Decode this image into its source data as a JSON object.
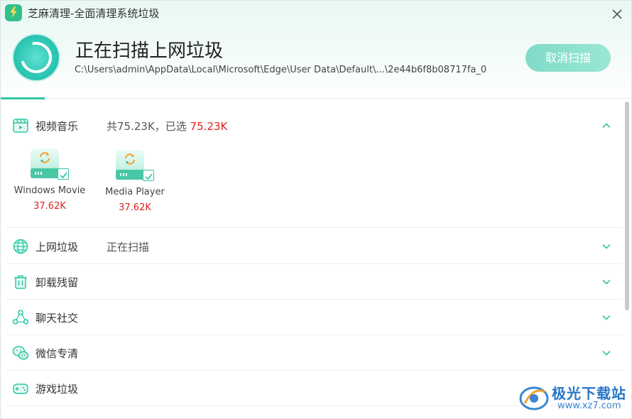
{
  "window": {
    "title": "芝麻清理-全面清理系统垃圾",
    "close_glyph": "✕"
  },
  "scan": {
    "title": "正在扫描上网垃圾",
    "path": "C:\\Users\\admin\\AppData\\Local\\Microsoft\\Edge\\User  Data\\Default\\...\\2e44b6f8b08717fa_0",
    "cancel_label": "取消扫描",
    "progress_fraction": 0.07
  },
  "sections": [
    {
      "label": "视频音乐",
      "icon": "video-music-icon",
      "status_total": "共75.23K，已选 ",
      "status_selected": "75.23K",
      "expanded": true,
      "items": [
        {
          "name": "Windows Movie",
          "size": "37.62K",
          "checked": true
        },
        {
          "name": "Media Player",
          "size": "37.62K",
          "checked": true
        }
      ]
    },
    {
      "label": "上网垃圾",
      "icon": "globe-icon",
      "status": "正在扫描",
      "expanded": false
    },
    {
      "label": "卸载残留",
      "icon": "trash-icon",
      "status": "",
      "expanded": false
    },
    {
      "label": "聊天社交",
      "icon": "social-icon",
      "status": "",
      "expanded": false
    },
    {
      "label": "微信专清",
      "icon": "wechat-icon",
      "status": "",
      "expanded": false
    },
    {
      "label": "游戏垃圾",
      "icon": "gamepad-icon",
      "status": "",
      "expanded": false
    }
  ],
  "colors": {
    "accent": "#2ec7a4",
    "highlight_red": "#e02020",
    "cancel_button": "#8fe1cf"
  },
  "watermark": {
    "name": "极光下载站",
    "url": "www.xz7.com"
  }
}
